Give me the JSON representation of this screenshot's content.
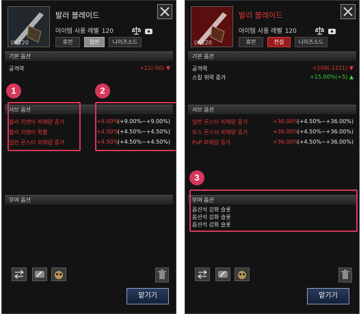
{
  "colors": {
    "accent_red": "#e23a3a",
    "highlight": "#d8375c",
    "green": "#3ccf3c"
  },
  "left": {
    "item_name": "발러 블레이드",
    "level_label": "아이템 사용 레벨",
    "level_value": "120",
    "thumb_level": "LV.120",
    "tabs": [
      "휴먼",
      "일반",
      "나이츠소드"
    ],
    "base_header": "기본 옵션",
    "base_rows": [
      {
        "label": "공격력",
        "value": "+22(-50)"
      }
    ],
    "sub_header": "서브 옵션",
    "sub_rows": [
      {
        "label": "물리 치명타 피해량 증가",
        "v1": "+9.00%",
        "v2": "(+9.00%~+9.00%)"
      },
      {
        "label": "물리 치명타 확률",
        "v1": "+4.50%",
        "v2": "(+4.50%~+4.50%)"
      },
      {
        "label": "일반 몬스터 피해량 증가",
        "v1": "+4.50%",
        "v2": "(+4.50%~+4.50%)"
      }
    ],
    "potential_header": "부여 옵션",
    "confirm_label": "맡기기",
    "badges": [
      "1",
      "2"
    ]
  },
  "right": {
    "item_name": "발러 블레이드",
    "level_label": "아이템 사용 레벨",
    "level_value": "120",
    "thumb_level": "LV.120",
    "tabs": [
      "휴먼",
      "전설",
      "나이츠소드"
    ],
    "base_header": "기본 옵션",
    "base_rows": [
      {
        "label": "공격력",
        "value": "+108(-1221)"
      },
      {
        "label": "스킬 위력 증가",
        "value": "+15.00%(+5)"
      }
    ],
    "sub_header": "서브 옵션",
    "sub_rows": [
      {
        "label": "일반 몬스터 피해량 증가",
        "v1": "+36.00%",
        "v2": "(+4.50%~+36.00%)"
      },
      {
        "label": "보스 몬스터 피해량 증가",
        "v1": "+36.00%",
        "v2": "(+4.50%~+36.00%)"
      },
      {
        "label": "PvP 피해량 증가",
        "v1": "+36.00%",
        "v2": "(+4.50%~+36.00%)"
      }
    ],
    "potential_header": "부여 옵션",
    "potential_lines": [
      "옵션석 강화 슬롯",
      "옵션석 강화 슬롯",
      "옵션석 강화 슬롯"
    ],
    "confirm_label": "맡기기",
    "badges": [
      "3"
    ]
  }
}
